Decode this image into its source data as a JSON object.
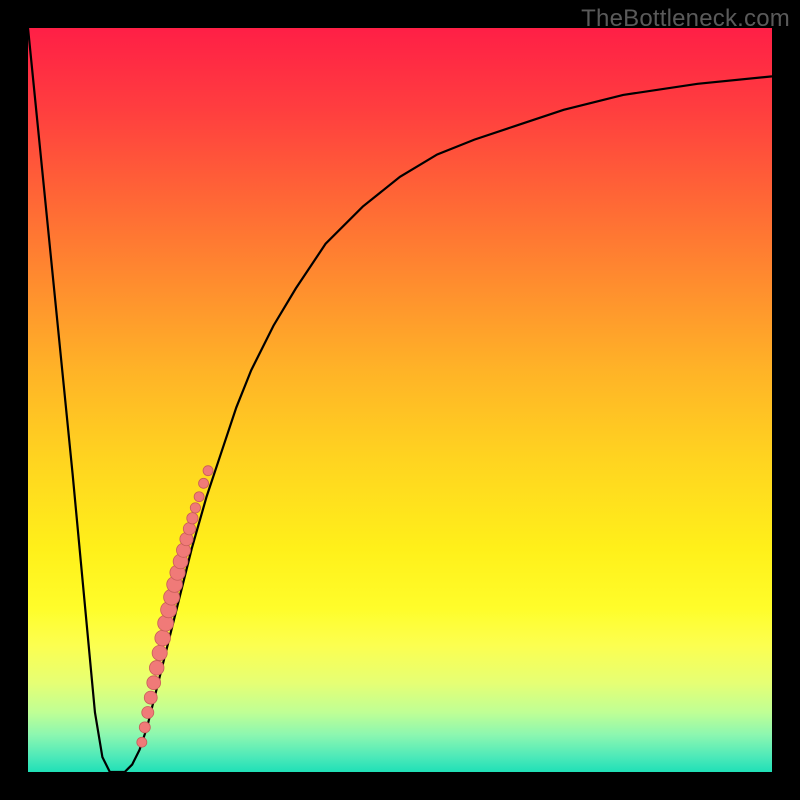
{
  "watermark": "TheBottleneck.com",
  "colors": {
    "frame": "#000000",
    "curve": "#000000",
    "dot_fill": "#f07a78",
    "dot_stroke": "#c85c5a",
    "gradient_top": "#ff1f46",
    "gradient_bottom": "#1fe0b7"
  },
  "chart_data": {
    "type": "line",
    "title": "",
    "xlabel": "",
    "ylabel": "",
    "xlim": [
      0,
      100
    ],
    "ylim": [
      0,
      100
    ],
    "series": [
      {
        "name": "bottleneck-curve",
        "x": [
          0,
          6,
          9,
          10,
          11,
          12,
          13,
          14,
          15,
          16,
          17,
          18,
          20,
          22,
          24,
          26,
          28,
          30,
          33,
          36,
          40,
          45,
          50,
          55,
          60,
          66,
          72,
          80,
          90,
          100
        ],
        "y": [
          100,
          40,
          8,
          2,
          0,
          0,
          0,
          1,
          3,
          6,
          10,
          14,
          22,
          30,
          37,
          43,
          49,
          54,
          60,
          65,
          71,
          76,
          80,
          83,
          85,
          87,
          89,
          91,
          92.5,
          93.5
        ]
      }
    ],
    "dots": {
      "name": "marked-points",
      "x": [
        15.3,
        15.7,
        16.1,
        16.5,
        16.9,
        17.3,
        17.7,
        18.1,
        18.5,
        18.9,
        19.3,
        19.7,
        20.1,
        20.5,
        20.9,
        21.3,
        21.7,
        22.1,
        22.5,
        23.0,
        23.6,
        24.2
      ],
      "y": [
        4.0,
        6.0,
        8.0,
        10.0,
        12.0,
        14.0,
        16.0,
        18.0,
        20.0,
        21.8,
        23.5,
        25.2,
        26.8,
        28.3,
        29.8,
        31.3,
        32.7,
        34.1,
        35.5,
        37.0,
        38.8,
        40.5
      ]
    }
  }
}
